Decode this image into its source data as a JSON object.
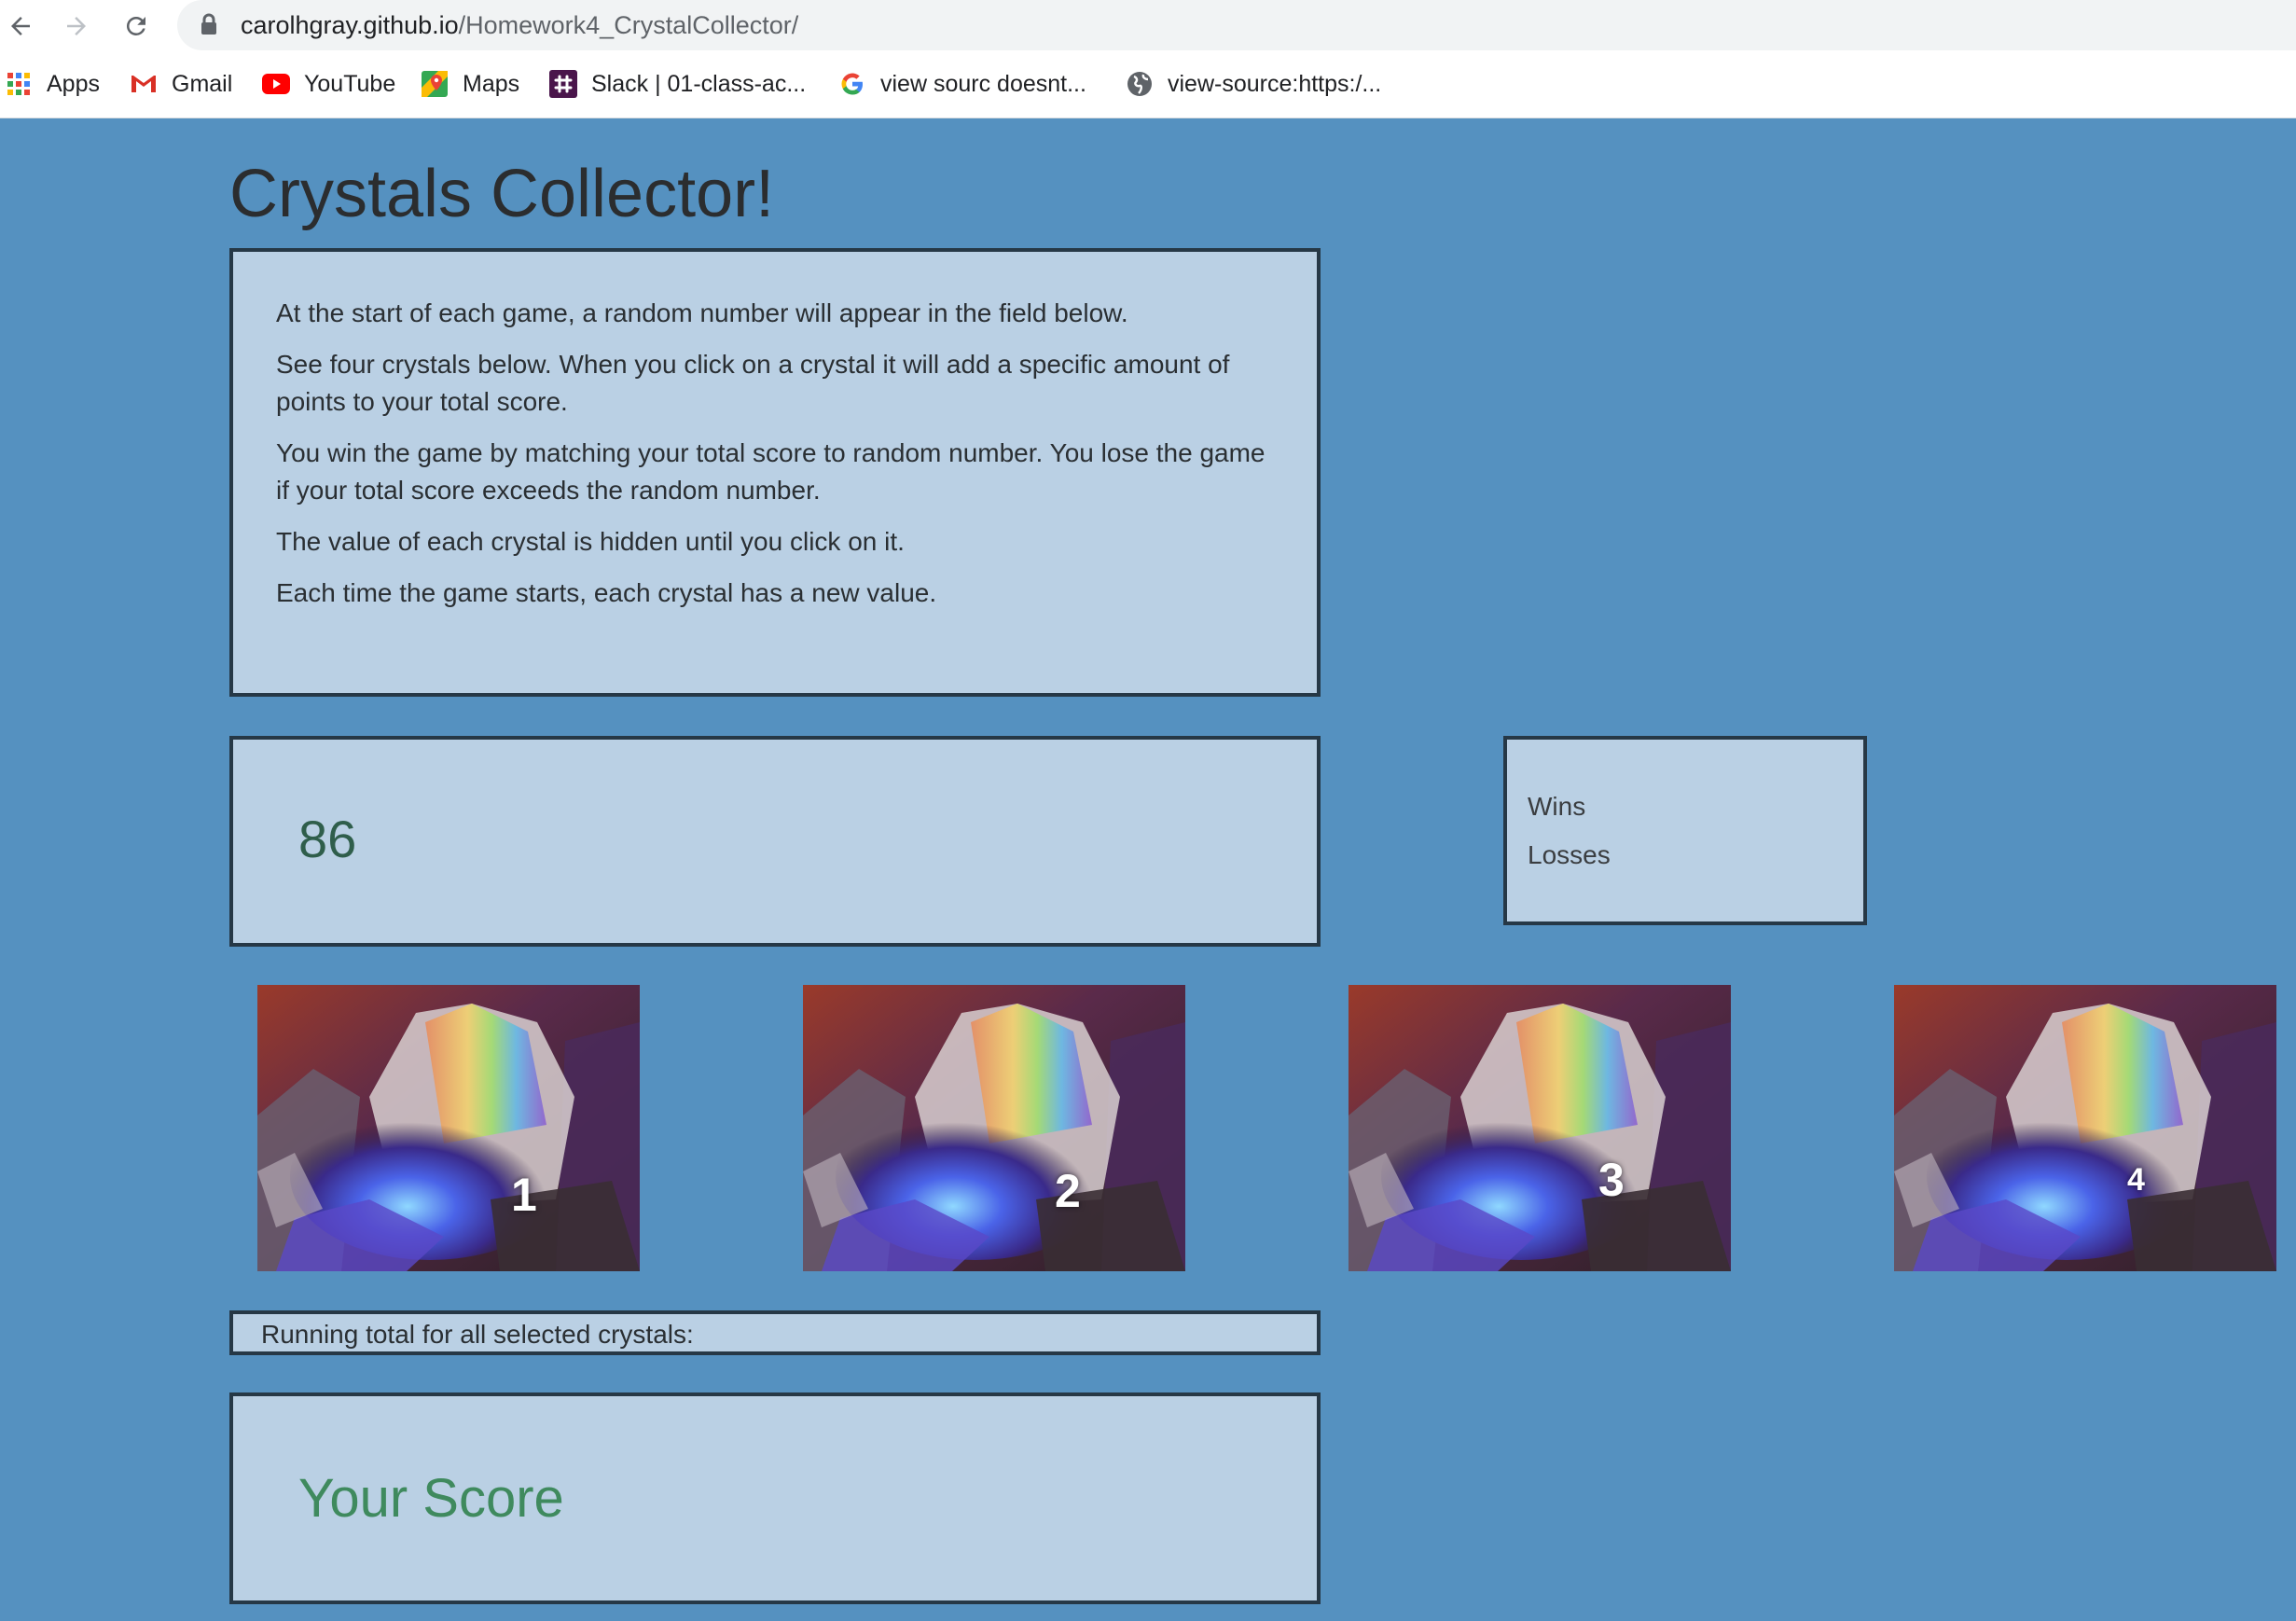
{
  "browser": {
    "url_host": "carolhgray.github.io",
    "url_path": "/Homework4_CrystalCollector/",
    "bookmarks": [
      {
        "label": "Apps",
        "icon": "apps-grid-icon"
      },
      {
        "label": "Gmail",
        "icon": "gmail-icon"
      },
      {
        "label": "YouTube",
        "icon": "youtube-icon"
      },
      {
        "label": "Maps",
        "icon": "maps-icon"
      },
      {
        "label": "Slack | 01-class-ac...",
        "icon": "slack-icon"
      },
      {
        "label": "view sourc doesnt...",
        "icon": "google-icon"
      },
      {
        "label": "view-source:https:/...",
        "icon": "globe-icon"
      }
    ]
  },
  "game": {
    "title": "Crystals Collector!",
    "instructions": [
      "At the start of each game, a random number will appear in the field below.",
      "See four crystals below. When you click on a crystal it will add a specific amount of points to your total score.",
      "You win the game by matching your total score to random number. You lose the game if your total score exceeds the random number.",
      "The value of each crystal is hidden until you click on it.",
      "Each time the game starts, each crystal has a new value."
    ],
    "target_number": "86",
    "wins_label": "Wins",
    "losses_label": "Losses",
    "crystals": [
      {
        "label": "1"
      },
      {
        "label": "2"
      },
      {
        "label": "3"
      },
      {
        "label": "4"
      }
    ],
    "running_total_label": "Running total for all selected crystals:",
    "score_label": "Your Score"
  },
  "colors": {
    "page_background": "#5591c0",
    "panel_background": "#bad0e4",
    "panel_border": "#263846",
    "target_text": "#2f5e4b",
    "score_text": "#3f8a5e"
  }
}
